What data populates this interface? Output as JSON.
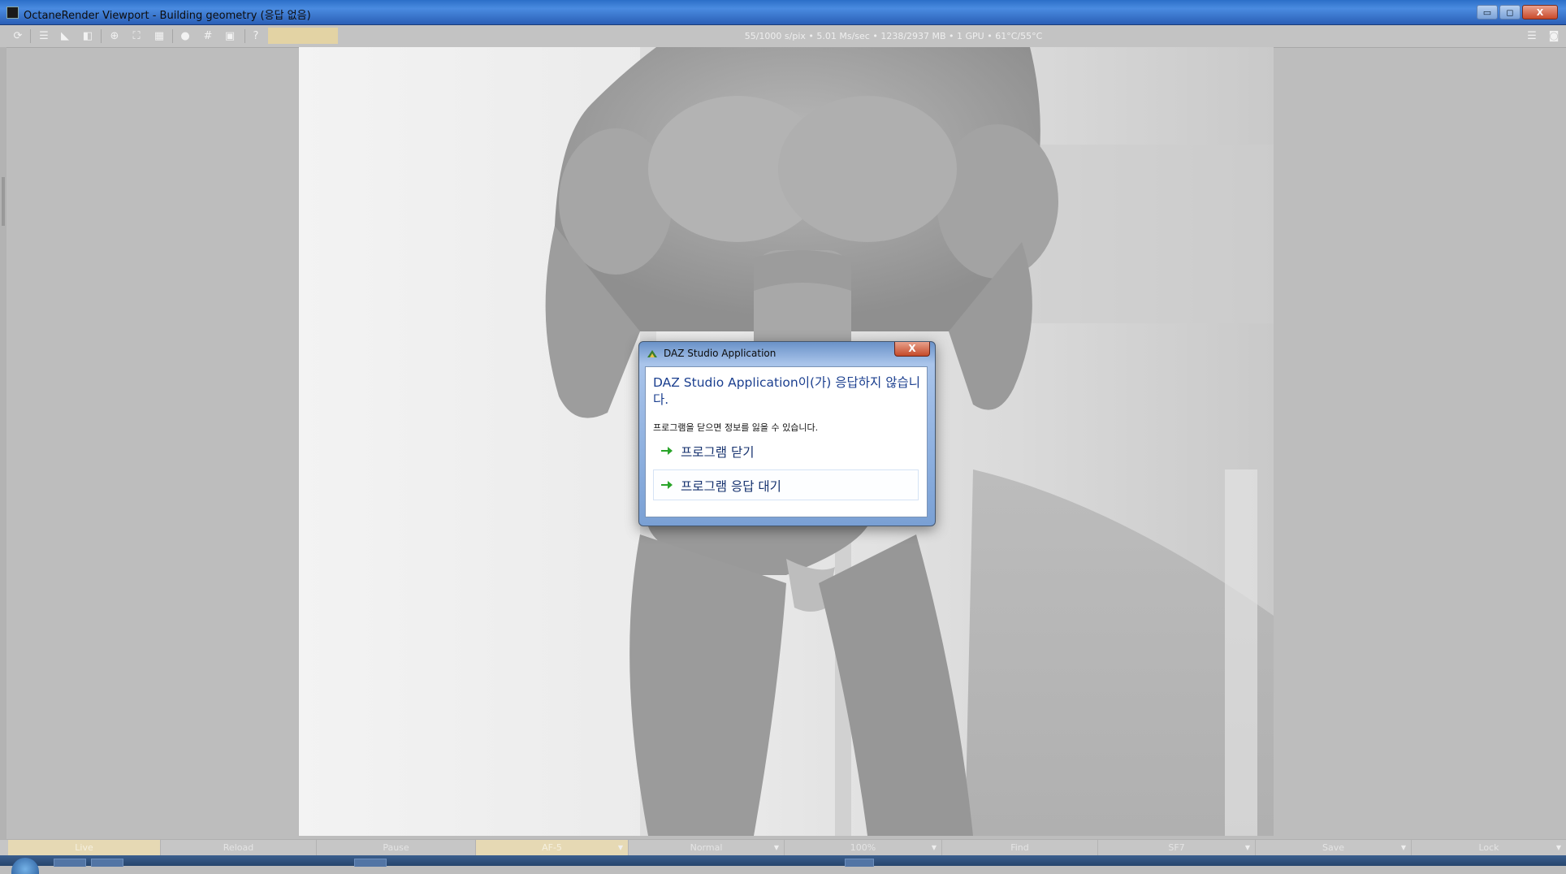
{
  "window": {
    "title": "OctaneRender Viewport - Building geometry (응답 없음)",
    "controls": {
      "minimize": "▭",
      "maximize": "◻",
      "close": "X"
    }
  },
  "toolbar": {
    "stats": "55/1000 s/pix • 5.01 Ms/sec • 1238/2937 MB • 1 GPU • 61°C/55°C",
    "icons": [
      "reset-icon",
      "film-settings-icon",
      "pick-focus-icon",
      "pick-material-icon",
      "pick-object-icon",
      "zoom-region-icon",
      "grid-icon",
      "viewport-lock-icon",
      "render-region-icon",
      "background-image-icon",
      "help-icon"
    ]
  },
  "dialog": {
    "title": "DAZ Studio Application",
    "heading": "DAZ Studio Application이(가) 응답하지 않습니다.",
    "message": "프로그램을 닫으면 정보를 잃을 수 있습니다.",
    "options": [
      {
        "label": "프로그램 닫기"
      },
      {
        "label": "프로그램 응답 대기"
      }
    ],
    "close_glyph": "X"
  },
  "bottombar": {
    "items": [
      "Live",
      "Reload",
      "Pause",
      "AF-5",
      "Normal",
      "100%",
      "Find",
      "SF7",
      "Save",
      "Lock"
    ]
  },
  "colors": {
    "title_gradient_top": "#2c6fc8",
    "dialog_heading": "#1b3f8f",
    "highlight": "#e6d9b4",
    "arrow": "#2aa52a"
  }
}
